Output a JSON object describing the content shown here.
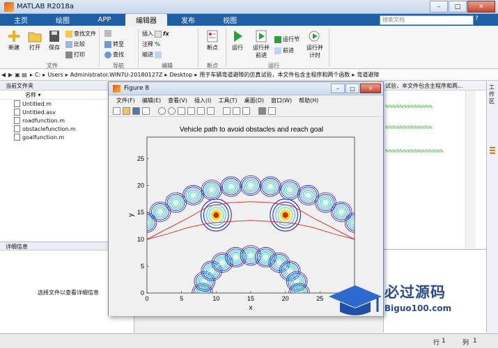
{
  "window": {
    "title": "MATLAB R2018a",
    "minimize": "–",
    "maximize": "□",
    "close": "✕"
  },
  "tabs": [
    "主页",
    "绘图",
    "APP",
    "编辑器",
    "发布",
    "视图"
  ],
  "search": {
    "placeholder": "搜索文档"
  },
  "ribbon": {
    "new": "新建",
    "open": "打开",
    "save": "保存",
    "find_files": "查找文件",
    "compare": "比较",
    "print": "打印",
    "goto": "转至",
    "find": "查找",
    "insert": "插入",
    "comment": "注释",
    "indent": "缩进",
    "breakpoints": "断点",
    "run": "运行",
    "run_advance": "运行并\n前进",
    "run_section": "运行节",
    "advance": "前进",
    "run_time": "运行并\n计时",
    "groups": {
      "file": "文件",
      "navigate": "导航",
      "edit": "编辑",
      "breakpoints": "断点",
      "run": "运行"
    }
  },
  "address": {
    "segments": [
      "C:",
      "Users",
      "Administrator.WIN7U-20180127Z",
      "Desktop",
      "用于车辆弯道避障的仿真试验，本文件包含主程序和两个函数",
      "弯道避障"
    ]
  },
  "file_panel": {
    "title": "当前文件夹",
    "column": "名称 ▾",
    "files": [
      "Untitled.m",
      "Untitled.asv",
      "roadfunction.m",
      "obstaclefunction.m",
      "goalfunction.m"
    ]
  },
  "details": {
    "title": "详细信息",
    "message": "选择文件以查看详细信息"
  },
  "editor": {
    "tab": "试验，本文件包含主程序和两...",
    "lines": [
      "%%%%%%%%%%%%%",
      "%%%%%%%%%%%%%",
      "%%%%%%%%%%%%%%%%"
    ]
  },
  "right_bar": {
    "label": "工作区"
  },
  "figure": {
    "title": "Figure 8",
    "menu": [
      "文件(F)",
      "编辑(E)",
      "查看(V)",
      "插入(I)",
      "工具(T)",
      "桌面(D)",
      "窗口(W)",
      "帮助(H)"
    ]
  },
  "status": {
    "row_label": "行",
    "row": "1",
    "col_label": "列",
    "col": "1"
  },
  "watermark": {
    "brand": "必过源码",
    "url": "Biguo100.com"
  },
  "chart_data": {
    "type": "contour",
    "title": "Vehicle path to avoid obstacles and reach goal",
    "xlabel": "x",
    "ylabel": "y",
    "xlim": [
      0,
      30
    ],
    "ylim": [
      0,
      29
    ],
    "xticks": [
      0,
      5,
      10,
      15,
      20,
      25,
      30
    ],
    "yticks": [
      0,
      5,
      10,
      15,
      20,
      25
    ],
    "road_outer": {
      "center": [
        15,
        0
      ],
      "radius": 20
    },
    "road_inner": {
      "center": [
        15,
        0
      ],
      "radius": 7
    },
    "obstacles": [
      {
        "x": 10,
        "y": 14.5
      },
      {
        "x": 20,
        "y": 14.5
      }
    ],
    "path_upper": [
      [
        0,
        10
      ],
      [
        3,
        12
      ],
      [
        6,
        14
      ],
      [
        9,
        16.2
      ],
      [
        12,
        16.8
      ],
      [
        15,
        17
      ],
      [
        18,
        16.8
      ],
      [
        21,
        16.2
      ],
      [
        24,
        14
      ],
      [
        27,
        12
      ],
      [
        30,
        10
      ]
    ],
    "path_lower": [
      [
        0,
        10
      ],
      [
        3,
        11
      ],
      [
        6,
        12.2
      ],
      [
        9,
        13
      ],
      [
        12,
        13.3
      ],
      [
        15,
        13.5
      ],
      [
        18,
        13.3
      ],
      [
        21,
        13
      ],
      [
        24,
        12.2
      ],
      [
        27,
        11
      ],
      [
        30,
        10
      ]
    ],
    "colors": {
      "path": "#e02020",
      "contour_outer": "#2020c0",
      "contour_mid": "#30c0f0",
      "contour_inner": "#40f0c0",
      "peak": "#f0e020",
      "core": "#e02000"
    }
  }
}
